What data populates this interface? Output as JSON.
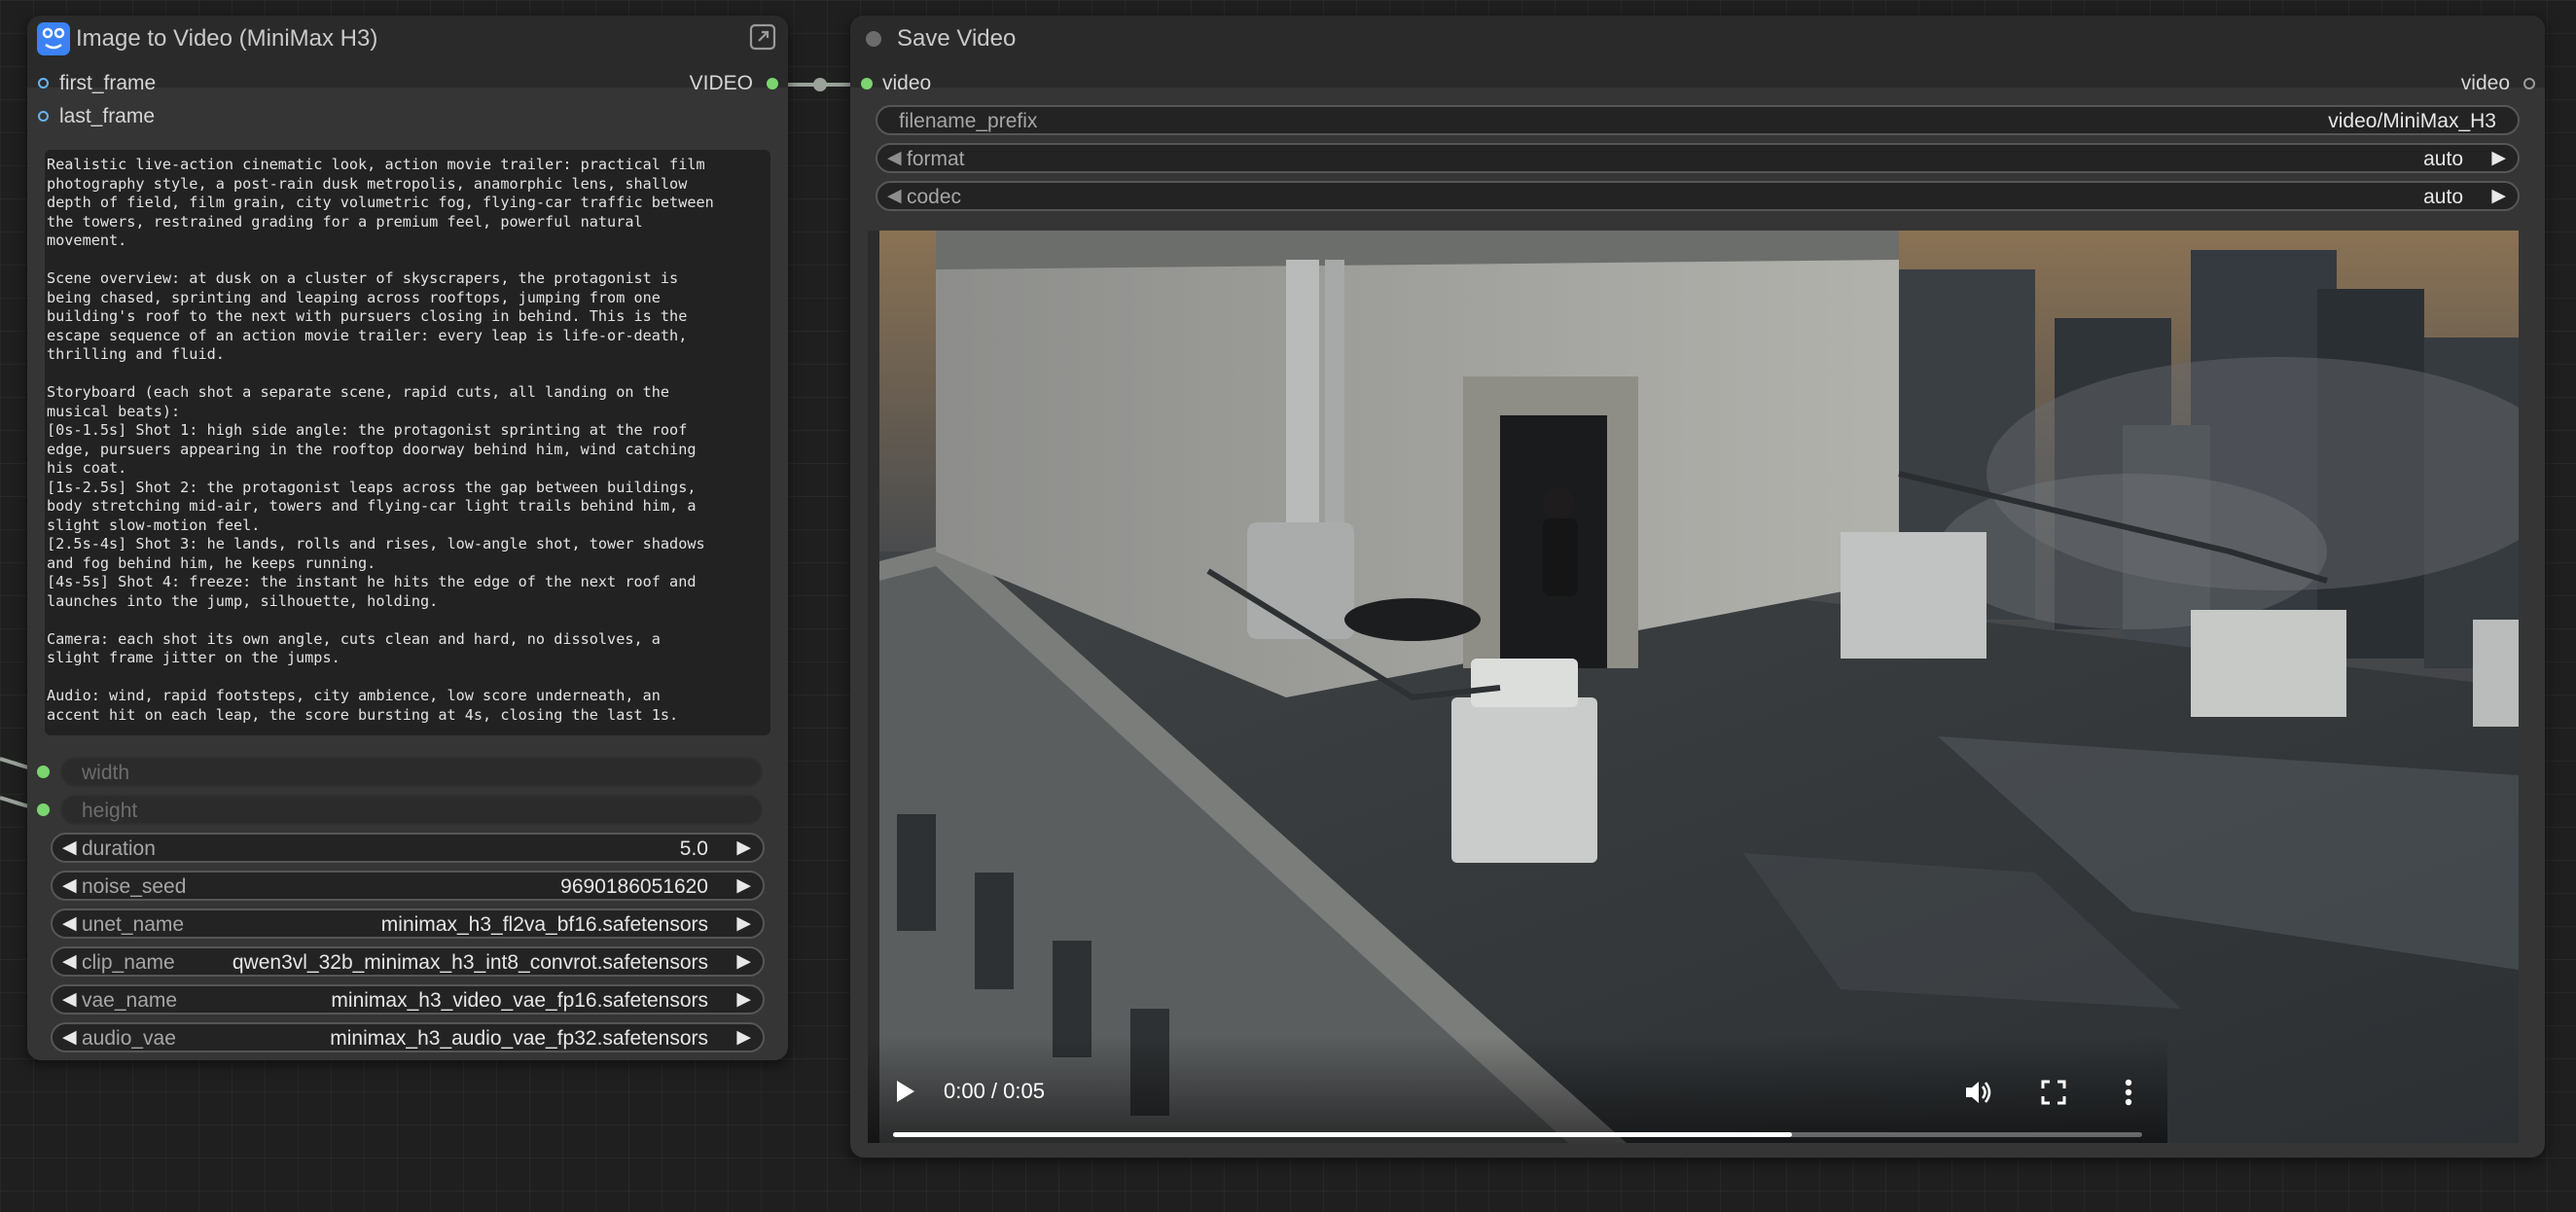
{
  "image_to_video_node": {
    "title": "Image to Video (MiniMax H3)",
    "inputs": [
      "first_frame",
      "last_frame"
    ],
    "output": "VIDEO",
    "prompt": "Realistic live-action cinematic look, action movie trailer: practical film\nphotography style, a post-rain dusk metropolis, anamorphic lens, shallow\ndepth of field, film grain, city volumetric fog, flying-car traffic between\nthe towers, restrained grading for a premium feel, powerful natural\nmovement.\n\nScene overview: at dusk on a cluster of skyscrapers, the protagonist is\nbeing chased, sprinting and leaping across rooftops, jumping from one\nbuilding's roof to the next with pursuers closing in behind. This is the\nescape sequence of an action movie trailer: every leap is life-or-death,\nthrilling and fluid.\n\nStoryboard (each shot a separate scene, rapid cuts, all landing on the\nmusical beats):\n[0s-1.5s] Shot 1: high side angle: the protagonist sprinting at the roof\nedge, pursuers appearing in the rooftop doorway behind him, wind catching\nhis coat.\n[1s-2.5s] Shot 2: the protagonist leaps across the gap between buildings,\nbody stretching mid-air, towers and flying-car light trails behind him, a\nslight slow-motion feel.\n[2.5s-4s] Shot 3: he lands, rolls and rises, low-angle shot, tower shadows\nand fog behind him, he keeps running.\n[4s-5s] Shot 4: freeze: the instant he hits the edge of the next roof and\nlaunches into the jump, silhouette, holding.\n\nCamera: each shot its own angle, cuts clean and hard, no dissolves, a\nslight frame jitter on the jumps.\n\nAudio: wind, rapid footsteps, city ambience, low score underneath, an\naccent hit on each leap, the score bursting at 4s, closing the last 1s.",
    "converted_inputs": [
      "width",
      "height"
    ],
    "widgets": [
      {
        "label": "duration",
        "value": "5.0"
      },
      {
        "label": "noise_seed",
        "value": "9690186051620"
      },
      {
        "label": "unet_name",
        "value": "minimax_h3_fl2va_bf16.safetensors"
      },
      {
        "label": "clip_name",
        "value": "qwen3vl_32b_minimax_h3_int8_convrot.safetensors"
      },
      {
        "label": "vae_name",
        "value": "minimax_h3_video_vae_fp16.safetensors"
      },
      {
        "label": "audio_vae",
        "value": "minimax_h3_audio_vae_fp32.safetensors"
      }
    ]
  },
  "save_video_node": {
    "title": "Save Video",
    "input": "video",
    "output": "video",
    "filename_prefix": {
      "label": "filename_prefix",
      "value": "video/MiniMax_H3"
    },
    "format": {
      "label": "format",
      "value": "auto"
    },
    "codec": {
      "label": "codec",
      "value": "auto"
    },
    "player": {
      "time_display": "0:00 / 0:05",
      "progress": 0.72
    }
  },
  "colors": {
    "canvas": "#1f1f20",
    "node_body": "#353535",
    "node_header": "#2a2a2a",
    "image_slot": "#64b5f6",
    "video_slot": "#7bd66f",
    "brand_icon": "#3b82f6"
  },
  "icons": [
    "node-brand-icon",
    "expand-icon",
    "play-icon",
    "volume-icon",
    "fullscreen-icon",
    "more-vert-icon"
  ]
}
